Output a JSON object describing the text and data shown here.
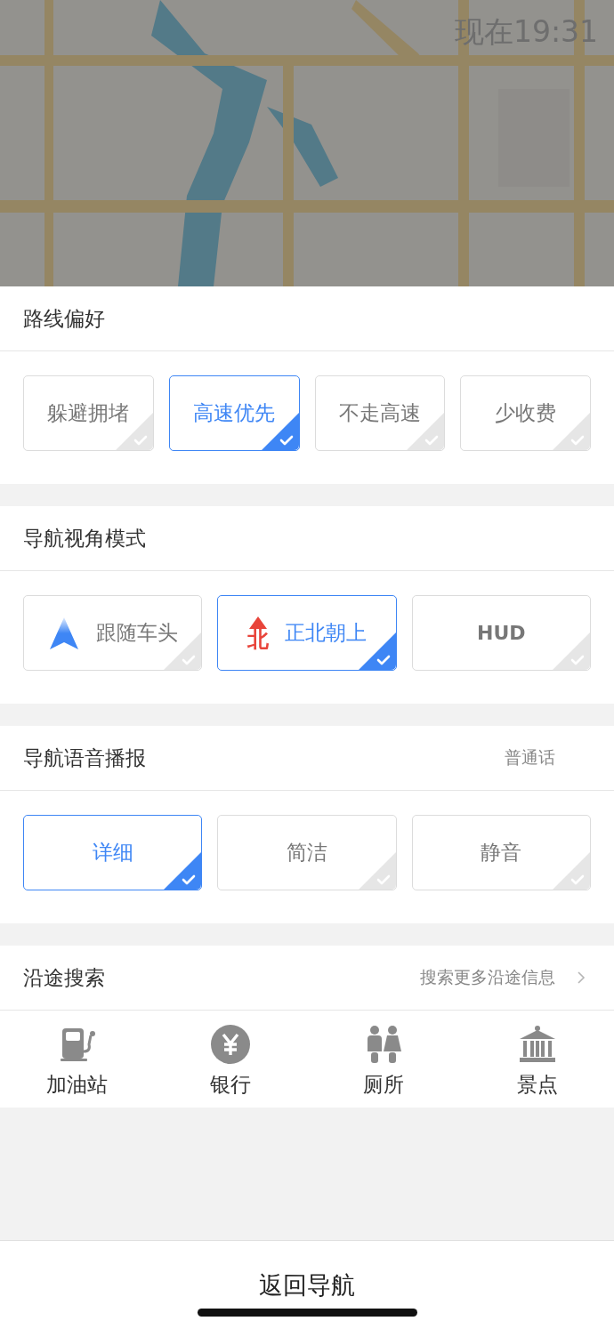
{
  "map": {
    "kind": "picture",
    "clock": "现在19:31"
  },
  "sections": [
    {
      "title": "路线偏好",
      "options": [
        {
          "label": "躲避拥堵",
          "selected": false
        },
        {
          "label": "高速优先",
          "selected": true
        },
        {
          "label": "不走高速",
          "selected": false
        },
        {
          "label": "少收费",
          "selected": false
        }
      ]
    },
    {
      "title": "导航视角模式",
      "options": [
        {
          "label": "跟随车头",
          "selected": false,
          "kind": "arrow"
        },
        {
          "label": "正北朝上",
          "selected": true,
          "kind": "north",
          "badge": "北"
        },
        {
          "label": "HUD",
          "selected": false,
          "kind": "latin"
        }
      ]
    },
    {
      "title": "导航语音播报",
      "extra": "普通话",
      "options": [
        {
          "label": "详细",
          "selected": true
        },
        {
          "label": "简洁",
          "selected": false
        },
        {
          "label": "静音",
          "selected": false
        }
      ]
    }
  ],
  "along_route": {
    "title": "沿途搜索",
    "link": "搜索更多沿途信息",
    "categories": [
      {
        "label": "加油站",
        "kind": "fuel"
      },
      {
        "label": "银行",
        "kind": "bank"
      },
      {
        "label": "厕所",
        "kind": "toilet"
      },
      {
        "label": "景点",
        "kind": "sight"
      }
    ]
  },
  "bottom_button": "返回导航"
}
